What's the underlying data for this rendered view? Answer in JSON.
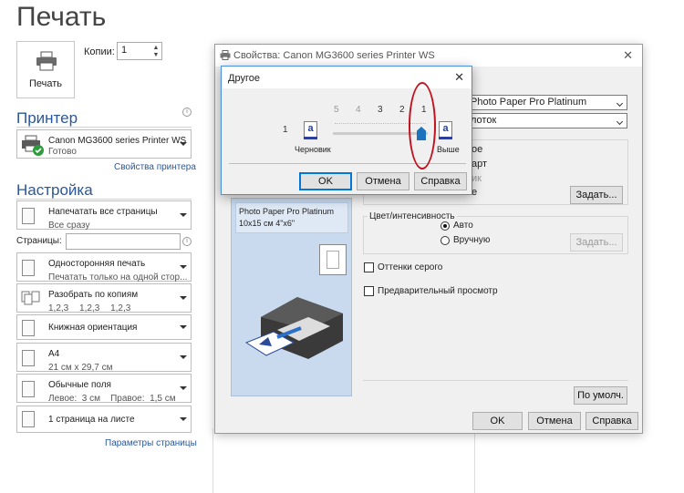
{
  "left": {
    "title": "Печать",
    "print_button": "Печать",
    "copies_label": "Копии:",
    "copies_value": "1",
    "printer_heading": "Принтер",
    "printer_name": "Canon MG3600 series Printer WS",
    "printer_status": "Готово",
    "printer_properties_link": "Свойства принтера",
    "settings_heading": "Настройка",
    "pages_label": "Страницы:",
    "settings": [
      {
        "line1": "Напечатать все страницы",
        "line2": "Все сразу"
      },
      {
        "line1": "Односторонняя печать",
        "line2": "Печатать только на одной стор..."
      },
      {
        "line1": "Разобрать по копиям",
        "line2_parts": [
          "1,2,3",
          "1,2,3",
          "1,2,3"
        ]
      },
      {
        "line1": "Книжная ориентация"
      },
      {
        "line1": "A4",
        "line2": "21 см x 29,7 см"
      },
      {
        "line1": "Обычные поля",
        "line2": "Левое:  3 см    Правое:  1,5 см"
      },
      {
        "line1": "1 страница на листе"
      }
    ],
    "page_setup_link": "Параметры страницы"
  },
  "properties": {
    "title": "Свойства: Canon MG3600 series Printer WS",
    "media_type": "Photo Paper Pro Platinum",
    "paper_source": "лоток",
    "quality_options": [
      "ое",
      "арт",
      "ик",
      "е"
    ],
    "set_button": "Задать...",
    "media_preview_line1": "Photo Paper Pro Platinum",
    "media_preview_line2": "10x15 см 4\"x6\"",
    "color_group_label": "Цвет/интенсивность",
    "color_auto": "Авто",
    "color_manual": "Вручную",
    "set_button_disabled": "Задать...",
    "grayscale_label": "Оттенки серого",
    "preview_label": "Предварительный просмотр",
    "defaults_button": "По умолч.",
    "ok": "OK",
    "cancel": "Отмена",
    "help": "Справка"
  },
  "other_dialog": {
    "title": "Другое",
    "ticks": [
      "5",
      "4",
      "3",
      "2",
      "1"
    ],
    "left_tick": "1",
    "draft_label": "Черновик",
    "high_label": "Выше",
    "selected_quality": 1,
    "ok": "OK",
    "cancel": "Отмена",
    "help": "Справка"
  },
  "colors": {
    "accent_blue": "#2b579a",
    "annotation_red": "#c1121f",
    "slider_thumb": "#1e73be"
  }
}
